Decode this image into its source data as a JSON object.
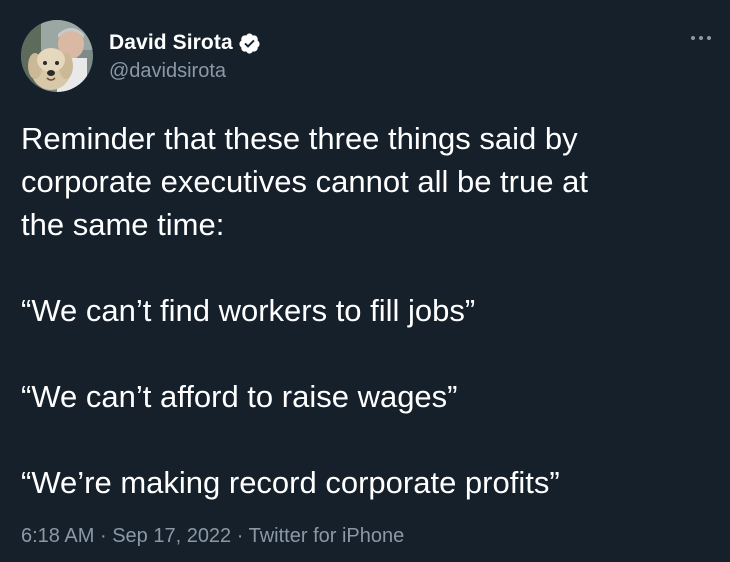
{
  "author": {
    "display_name": "David Sirota",
    "handle": "@davidsirota",
    "verified": true,
    "avatar_icon": "avatar-photo-dog-icon"
  },
  "menu": {
    "icon": "more-dots-icon"
  },
  "tweet": {
    "intro_lines": [
      "Reminder that these three things said by",
      "corporate executives cannot all be true at",
      "the same time:"
    ],
    "quotes": [
      "“We can’t find workers to fill jobs”",
      "“We can’t afford to raise wages”",
      "“We’re making record corporate profits”"
    ]
  },
  "meta": {
    "time": "6:18 AM",
    "separator": "·",
    "date": "Sep 17, 2022",
    "source": "Twitter for iPhone"
  },
  "colors": {
    "background": "#15202b",
    "text_primary": "#ffffff",
    "text_secondary": "#8b98a5",
    "verified_badge": "#ffffff"
  }
}
